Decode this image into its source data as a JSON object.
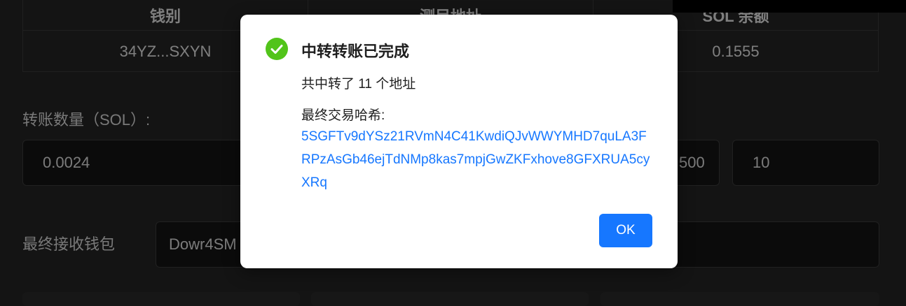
{
  "table": {
    "headers": [
      "钱别",
      "测目地址",
      "SOL 余额"
    ],
    "row": [
      "34YZ...SXYN",
      "",
      "0.1555"
    ]
  },
  "transfer": {
    "label": "转账数量（SOL）:",
    "amount": "0.0024",
    "field2": "500",
    "field3": "10"
  },
  "receiver": {
    "label": "最终接收钱包",
    "value": "Dowr4SM"
  },
  "modal": {
    "title": "中转转账已完成",
    "summary": "共中转了 11 个地址",
    "hash_label": "最终交易哈希:",
    "hash": "5SGFTv9dYSz21RVmN4C41KwdiQJvWWYMHD7quLA3FRPzAsGb46ejTdNMp8kas7mpjGwZKFxhove8GFXRUA5cyXRq",
    "ok_label": "OK",
    "icon": "check-circle-icon",
    "colors": {
      "accent": "#1677ff",
      "success": "#52c41a"
    }
  }
}
